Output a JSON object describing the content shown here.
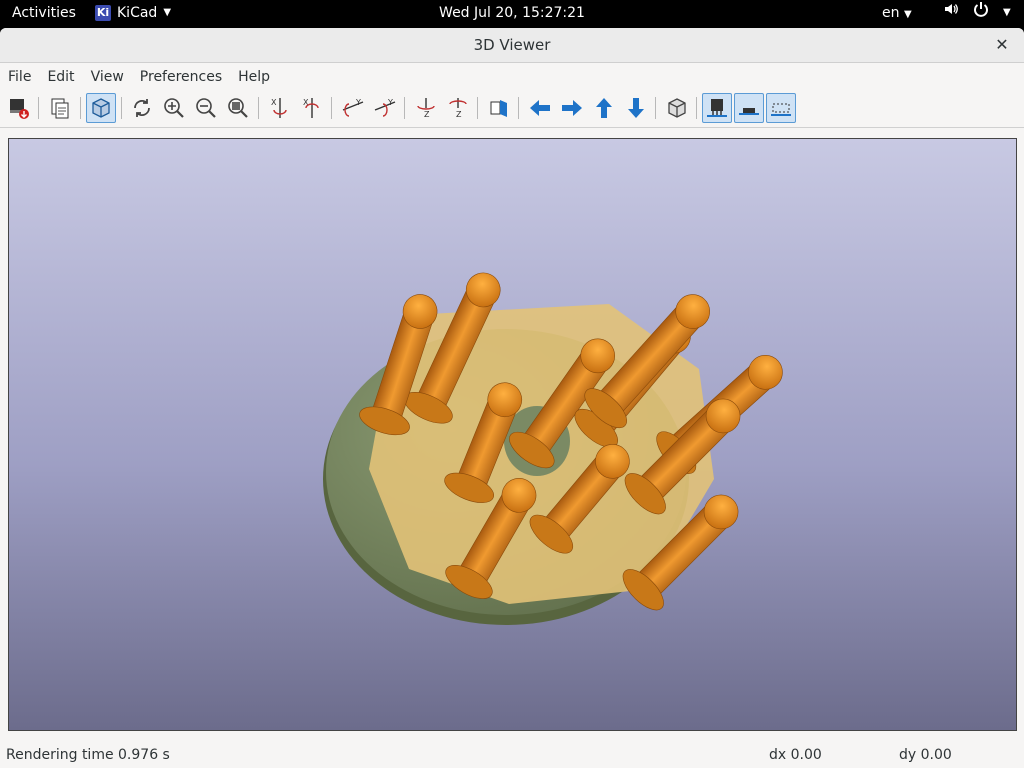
{
  "topbar": {
    "activities": "Activities",
    "app_badge": "Ki",
    "app_name": "KiCad",
    "clock": "Wed Jul 20, 15:27:21",
    "lang": "en"
  },
  "window": {
    "title": "3D Viewer",
    "close_glyph": "✕"
  },
  "menubar": {
    "items": [
      "File",
      "Edit",
      "View",
      "Preferences",
      "Help"
    ]
  },
  "toolbar": {
    "icons": [
      "reload-board-icon",
      "copy-icon",
      "raytrace-cube-icon",
      "refresh-icon",
      "zoom-in-icon",
      "zoom-out-icon",
      "zoom-fit-icon",
      "rotate-x-cw-icon",
      "rotate-x-ccw-icon",
      "rotate-y-cw-icon",
      "rotate-y-ccw-icon",
      "rotate-z-cw-icon",
      "rotate-z-ccw-icon",
      "flip-view-icon",
      "pan-left-icon",
      "pan-right-icon",
      "pan-up-icon",
      "pan-down-icon",
      "ortho-cube-icon",
      "tht-toggle-icon",
      "smd-toggle-icon",
      "virtual-toggle-icon"
    ]
  },
  "statusbar": {
    "render_time": "Rendering time 0.976 s",
    "dx": "dx 0.00",
    "dy": "dy 0.00"
  },
  "colors": {
    "accent": "#1e73c8",
    "pin": "#e08a20",
    "board": "#7a8a62",
    "bg_top": "#c8c9e3",
    "bg_bottom": "#6c6c8c"
  }
}
